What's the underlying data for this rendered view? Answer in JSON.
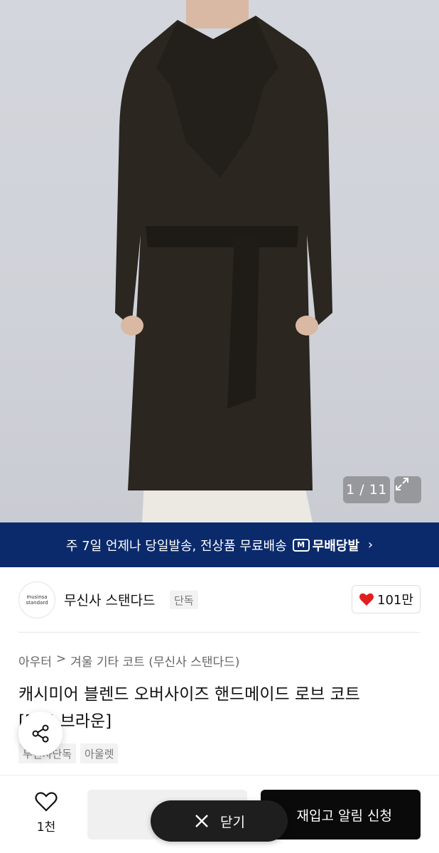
{
  "gallery": {
    "counter": "1 / 11"
  },
  "banner": {
    "text": "주 7일 언제나 당일발송, 전상품 무료배송",
    "brand": "무배당발",
    "badge": "M"
  },
  "brand": {
    "logo_line1": "musinsa",
    "logo_line2": "standard",
    "name": "무신사 스탠다드",
    "tag": "단독",
    "likes": "101만"
  },
  "breadcrumb": {
    "category": "아우터",
    "separator": ">",
    "subcategory": "겨울 기타 코트 (무신사 스탠다드)"
  },
  "product": {
    "title_line1": "캐시미어 블렌드 오버사이즈 핸드메이드 로브 코트",
    "title_line2": "[다크 브라운]",
    "tags": [
      "무신사단독",
      "아울렛"
    ]
  },
  "bottom_bar": {
    "wish_count": "1천",
    "restock_label": "재입고 알림 신청",
    "close_label": "닫기"
  },
  "colors": {
    "banner": "#0b2a6b",
    "heart": "#e02020",
    "primary": "#0a0a0a"
  }
}
